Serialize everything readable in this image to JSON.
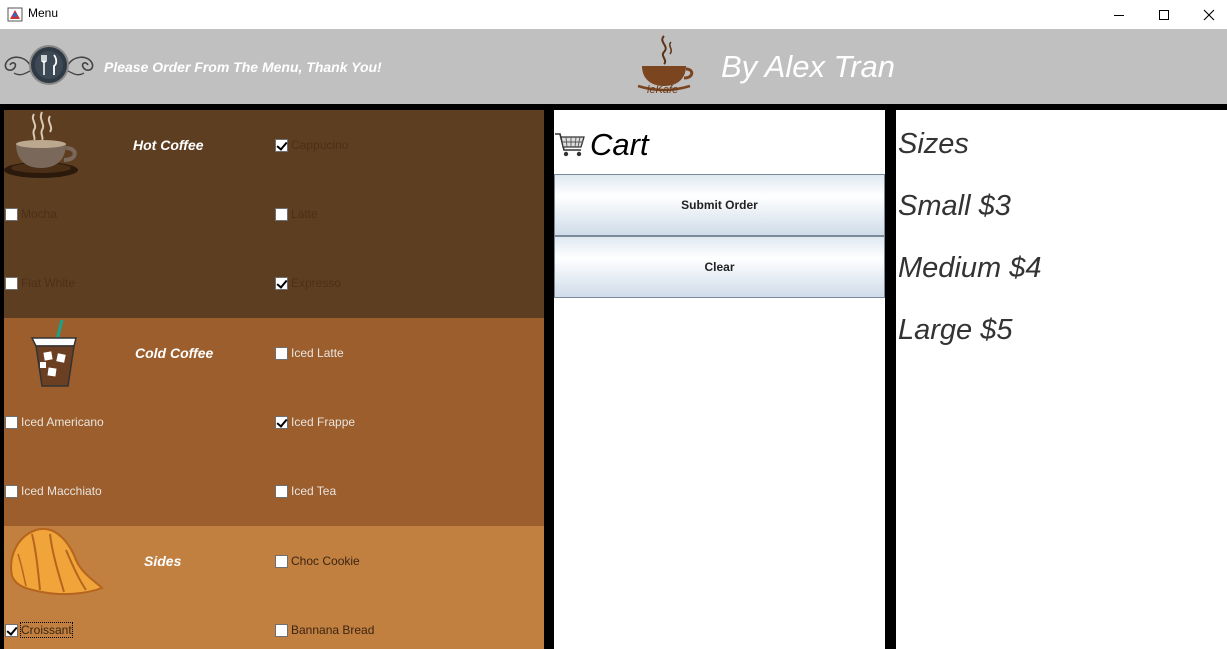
{
  "window": {
    "title": "Menu",
    "controls": {
      "minimize": "minimize-icon",
      "maximize": "maximize-icon",
      "close": "close-icon"
    }
  },
  "header": {
    "message": "Please Order From The Menu, Thank You!",
    "logo_text": "leKafe",
    "byline": "By Alex Tran"
  },
  "menu": {
    "hot": {
      "title": "Hot Coffee",
      "items": [
        {
          "label": "Cappucino",
          "checked": true
        },
        {
          "label": "Mocha",
          "checked": false
        },
        {
          "label": "Latte",
          "checked": false
        },
        {
          "label": "Flat White",
          "checked": false
        },
        {
          "label": "Expresso",
          "checked": true
        }
      ]
    },
    "cold": {
      "title": "Cold Coffee",
      "items": [
        {
          "label": "Iced Latte",
          "checked": false
        },
        {
          "label": "Iced Americano",
          "checked": false
        },
        {
          "label": "Iced Frappe",
          "checked": true
        },
        {
          "label": "Iced Macchiato",
          "checked": false
        },
        {
          "label": "Iced Tea",
          "checked": false
        }
      ]
    },
    "sides": {
      "title": "Sides",
      "items": [
        {
          "label": "Choc Cookie",
          "checked": false
        },
        {
          "label": "Croissant",
          "checked": true
        },
        {
          "label": "Bannana Bread",
          "checked": false
        }
      ]
    }
  },
  "cart": {
    "title": "Cart",
    "submit_label": "Submit Order",
    "clear_label": "Clear"
  },
  "sizes": {
    "title": "Sizes",
    "options": [
      "Small $3",
      "Medium $4",
      "Large $5"
    ]
  },
  "colors": {
    "hot_bg": "#5e3e20",
    "cold_bg": "#9b5e2c",
    "sides_bg": "#c17f40",
    "header_bg": "#c0c0c0"
  }
}
